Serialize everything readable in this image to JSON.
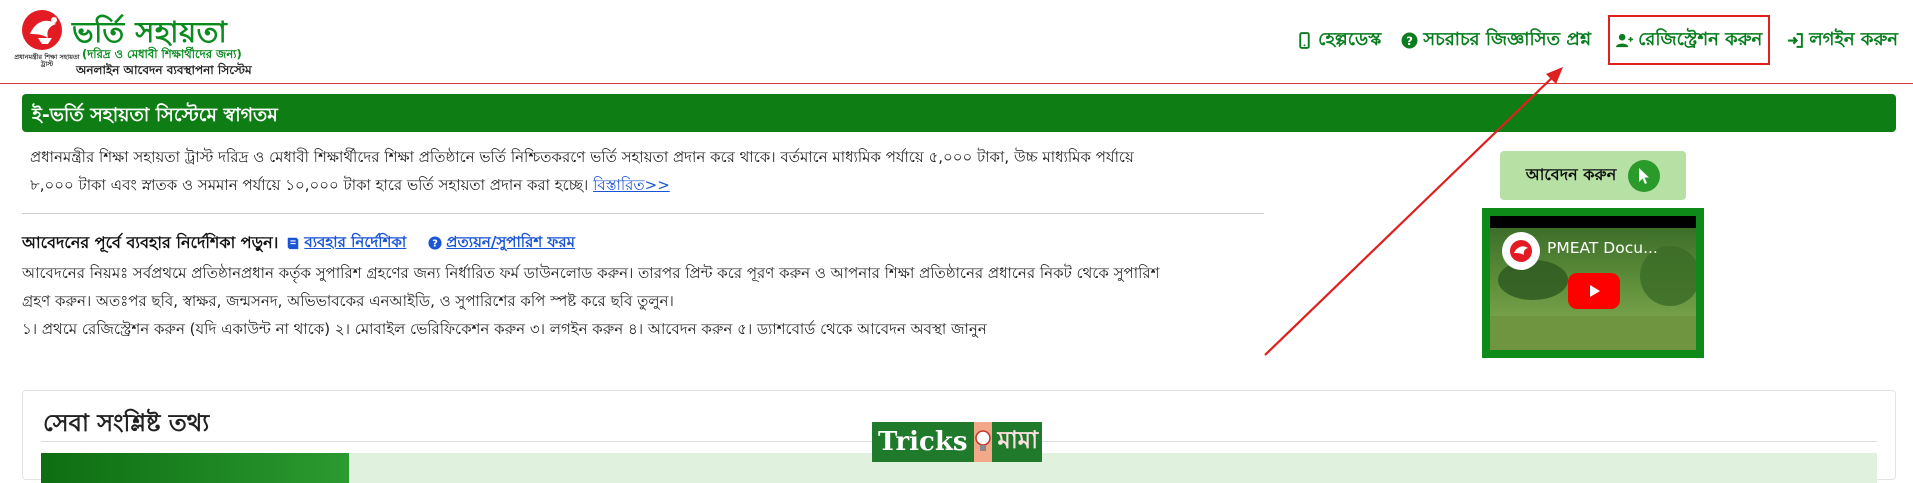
{
  "brand": {
    "title": "ভর্তি সহায়তা",
    "subtitle": "(দরিদ্র ও মেধাবী শিক্ষার্থীদের জন্য)",
    "tagline": "অনলাইন আবেদন ব্যবস্থাপনা সিস্টেম",
    "logo_caption": "প্রধানমন্ত্রীর শিক্ষা সহায়তা ট্রাস্ট"
  },
  "nav": {
    "helpdesk": "হেল্পডেস্ক",
    "faq": "সচরাচর জিজ্ঞাসিত প্রশ্ন",
    "register": "রেজিস্ট্রেশন করুন",
    "login": "লগইন করুন"
  },
  "banner": {
    "title": "ই-ভর্তি সহায়তা সিস্টেমে স্বাগতম"
  },
  "intro": {
    "line1": "প্রধানমন্ত্রীর শিক্ষা সহায়তা ট্রাস্ট দরিদ্র ও মেধাবী শিক্ষার্থীদের শিক্ষা প্রতিষ্ঠানে ভর্তি নিশ্চিতকরণে ভর্তি সহায়তা প্রদান করে থাকে। বর্তমানে মাধ্যমিক পর্যায়ে ৫,০০০ টাকা, উচ্চ মাধ্যমিক পর্যায়ে",
    "line2": "৮,০০০ টাকা এবং স্নাতক ও সমমান পর্যায়ে ১০,০০০ টাকা হারে ভর্তি সহায়তা প্রদান করা হচ্ছে।",
    "more_link": "বিস্তারিত>>"
  },
  "guide": {
    "lead": "আবেদনের পূর্বে ব্যবহার নির্দেশিকা পড়ুন।",
    "manual_link": "ব্যবহার নির্দেশিকা",
    "form_link": "প্রত্যয়ন/সুপারিশ ফরম",
    "rules_line1": "আবেদনের নিয়মঃ সর্বপ্রথমে প্রতিষ্ঠানপ্রধান কর্তৃক সুপারিশ গ্রহণের জন্য নির্ধারিত ফর্ম ডাউনলোড করুন। তারপর প্রিন্ট করে পূরণ করুন ও আপনার শিক্ষা প্রতিষ্ঠানের প্রধানের নিকট থেকে সুপারিশ",
    "rules_line2": "গ্রহণ করুন। অতঃপর ছবি, স্বাক্ষর, জন্মসনদ, অভিভাবকের এনআইডি, ও সুপারিশের কপি স্পষ্ট করে ছবি তুলুন।",
    "steps": "১। প্রথমে রেজিস্ট্রেশন করুন (যদি একাউন্ট না থাকে) ২। মোবাইল ভেরিফিকেশন করুন ৩। লগইন করুন ৪। আবেদন করুন ৫। ড্যাশবোর্ড থেকে আবেদন অবস্থা জানুন"
  },
  "apply": {
    "label": "আবেদন করুন"
  },
  "video": {
    "title": "PMEAT Docu..."
  },
  "service": {
    "title": "সেবা সংশ্লিষ্ট তথ্য"
  },
  "watermark": {
    "left": "Tricks",
    "right": "মামা"
  },
  "colors": {
    "brand_green": "#0a8a1f",
    "banner_green": "#0d7d14",
    "annotation_red": "#e01f1f",
    "link_blue": "#1a55d6"
  }
}
